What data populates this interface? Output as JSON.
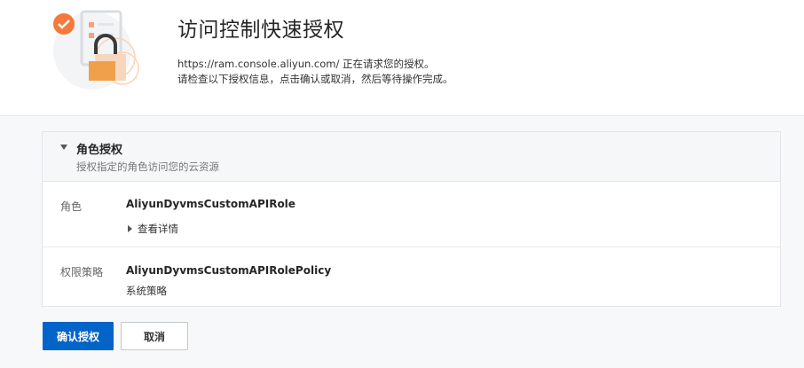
{
  "header": {
    "title": "访问控制快速授权",
    "desc_line1": "https://ram.console.aliyun.com/ 正在请求您的授权。",
    "desc_line2": "请检查以下授权信息，点击确认或取消，然后等待操作完成。"
  },
  "panel": {
    "title": "角色授权",
    "subtitle": "授权指定的角色访问您的云资源",
    "rows": [
      {
        "label": "角色",
        "value": "AliyunDyvmsCustomAPIRole",
        "link": "查看详情"
      },
      {
        "label": "权限策略",
        "value": "AliyunDyvmsCustomAPIRolePolicy",
        "sub": "系统策略"
      }
    ]
  },
  "actions": {
    "confirm": "确认授权",
    "cancel": "取消"
  },
  "colors": {
    "primary": "#0064c8",
    "accent_orange": "#f0a04b",
    "check_orange": "#f5793a"
  },
  "icons": {
    "illustration": "lock-document-check-illustration",
    "expand": "caret-down-icon",
    "detail": "caret-right-icon"
  }
}
